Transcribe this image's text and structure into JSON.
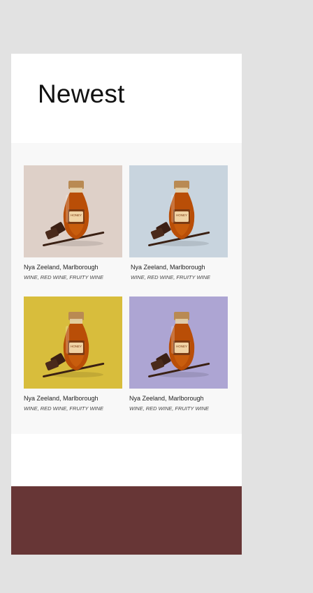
{
  "colors": {
    "page_background": "#e2e2e2",
    "footer_band": "#673636",
    "card_backgrounds": [
      "#ded0c8",
      "#c8d4de",
      "#d8bd3c",
      "#ada5d3"
    ]
  },
  "section": {
    "title": "Newest"
  },
  "products": [
    {
      "name": "Nya Zeeland, Marlborough",
      "tags": "WINE, RED WINE, FRUITY WINE",
      "image_icon": "honey-bottle-with-chocolate-icon",
      "bottle_label": "HONEY"
    },
    {
      "name": "Nya Zeeland, Marlborough",
      "tags": "WINE, RED WINE, FRUITY WINE",
      "image_icon": "honey-bottle-with-chocolate-icon",
      "bottle_label": "HONEY"
    },
    {
      "name": "Nya Zeeland, Marlborough",
      "tags": "WINE, RED WINE, FRUITY WINE",
      "image_icon": "honey-bottle-with-chocolate-icon",
      "bottle_label": "HONEY"
    },
    {
      "name": "Nya Zeeland, Marlborough",
      "tags": "WINE, RED WINE, FRUITY WINE",
      "image_icon": "honey-bottle-with-chocolate-icon",
      "bottle_label": "HONEY"
    }
  ]
}
